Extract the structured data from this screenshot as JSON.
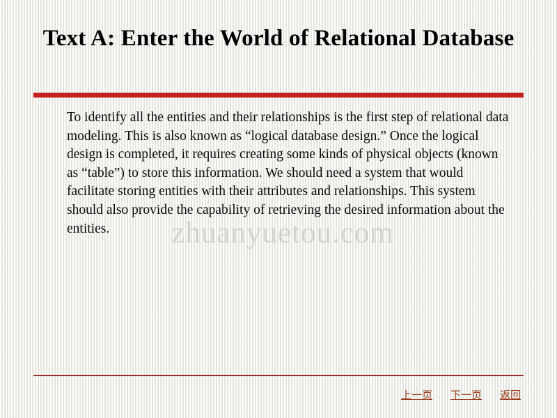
{
  "slide": {
    "title": "Text A: Enter the World of Relational Database",
    "body": "To identify all the entities and their relationships is the first step of relational data modeling. This is also known as “logical database design.” Once the logical design is completed, it requires creating some kinds of physical objects (known as “table”) to store this information. We should need a system that would facilitate storing entities with their attributes and relationships. This system should also provide the capability of retrieving the desired information about the entities.",
    "watermark": "zhuanyuetou.com",
    "colors": {
      "title_rule": "#c32020",
      "footer_rule": "#9b2c2c",
      "nav_link": "#9a3a18",
      "background": "#f3f3ef"
    },
    "nav": [
      {
        "label": "上一页",
        "name": "prev-page-link"
      },
      {
        "label": "下一页",
        "name": "next-page-link"
      },
      {
        "label": "返回",
        "name": "return-link"
      }
    ]
  }
}
